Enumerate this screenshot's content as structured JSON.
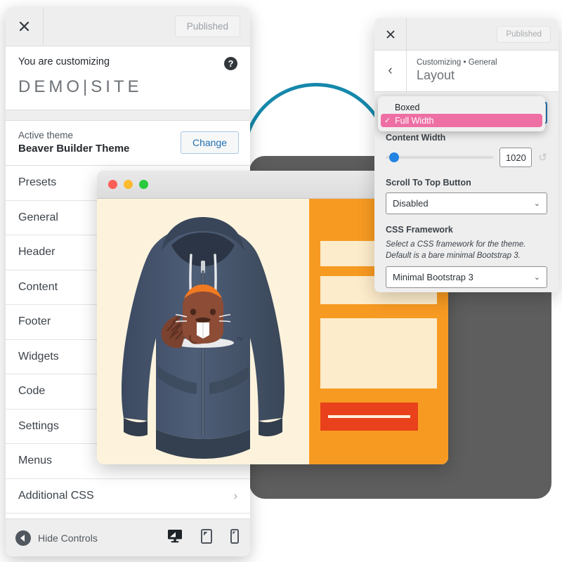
{
  "customizer": {
    "close_icon": "close-icon",
    "published_label": "Published",
    "customizing_label": "You are customizing",
    "help_icon": "?",
    "site_name": "DEMO|SITE",
    "active_theme_label": "Active theme",
    "theme_name": "Beaver Builder Theme",
    "change_button": "Change",
    "menu_items": [
      {
        "label": "Presets",
        "has_chevron": false
      },
      {
        "label": "General",
        "has_chevron": false
      },
      {
        "label": "Header",
        "has_chevron": false
      },
      {
        "label": "Content",
        "has_chevron": false
      },
      {
        "label": "Footer",
        "has_chevron": false
      },
      {
        "label": "Widgets",
        "has_chevron": false
      },
      {
        "label": "Code",
        "has_chevron": false
      },
      {
        "label": "Settings",
        "has_chevron": false
      },
      {
        "label": "Menus",
        "has_chevron": true
      },
      {
        "label": "Additional CSS",
        "has_chevron": true
      }
    ],
    "chevron_glyph": "›",
    "hide_controls_label": "Hide Controls",
    "devices": [
      {
        "name": "desktop-preview-icon",
        "active": true
      },
      {
        "name": "tablet-preview-icon",
        "active": false
      },
      {
        "name": "mobile-preview-icon",
        "active": false
      }
    ]
  },
  "panel": {
    "close_icon": "close-icon",
    "published_label": "Published",
    "back_glyph": "‹",
    "breadcrumb": "Customizing • General",
    "title": "Layout",
    "layout_dropdown": {
      "options": [
        {
          "label": "Boxed",
          "selected": false
        },
        {
          "label": "Full Width",
          "selected": true
        }
      ],
      "check_glyph": "✓",
      "highlight_color": "#ee6fa4"
    },
    "content_width": {
      "label": "Content Width",
      "value": "1020",
      "reset_glyph": "↺",
      "knob_color": "#2383e2"
    },
    "scroll_to_top": {
      "label": "Scroll To Top Button",
      "value": "Disabled"
    },
    "css_framework": {
      "label": "CSS Framework",
      "description": "Select a CSS framework for the theme. Default is a bare minimal Bootstrap 3.",
      "value": "Minimal Bootstrap 3"
    },
    "chevron_glyph": "⌄"
  },
  "browser_preview": {
    "traffic_lights": [
      "close-red-dot",
      "minimize-yellow-dot",
      "maximize-green-dot"
    ],
    "product_image": "navy-zip-hoodie-with-beaver-logo",
    "accent_color": "#f79a22",
    "cta_color": "#e8411b",
    "page_bg": "#fdf3dd"
  },
  "decor": {
    "ring_color": "#1588ab",
    "device_frame_color": "#5e5e5e"
  }
}
